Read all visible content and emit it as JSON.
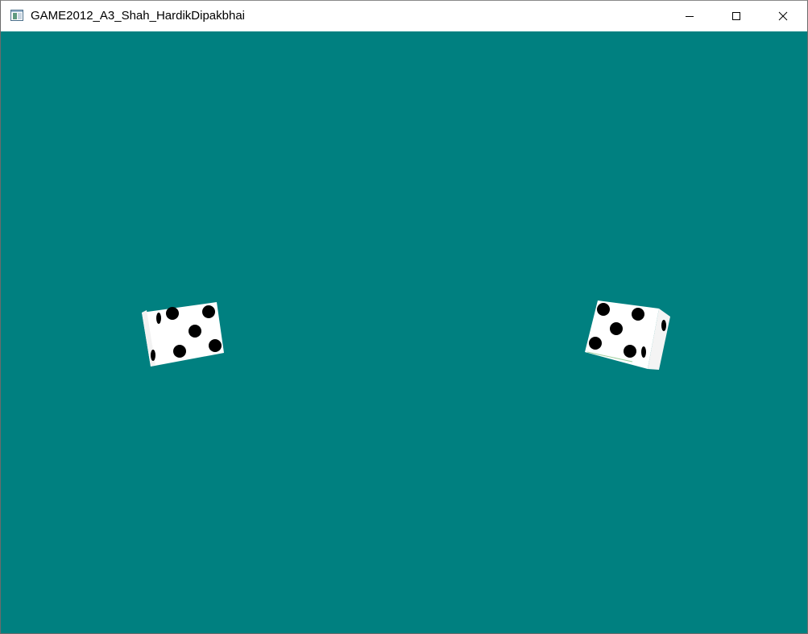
{
  "window": {
    "title": "GAME2012_A3_Shah_HardikDipakbhai",
    "icon": "app-window-icon",
    "controls": {
      "minimize_icon": "minimize-icon",
      "maximize_icon": "maximize-icon",
      "close_icon": "close-icon"
    }
  },
  "scene": {
    "background_color": "#008080",
    "dice": [
      {
        "name": "left-die",
        "visible_front_face_pips": 5,
        "color": "#ffffff",
        "pip_color": "#000000"
      },
      {
        "name": "right-die",
        "visible_front_face_pips": 5,
        "color": "#ffffff",
        "pip_color": "#000000"
      }
    ]
  }
}
